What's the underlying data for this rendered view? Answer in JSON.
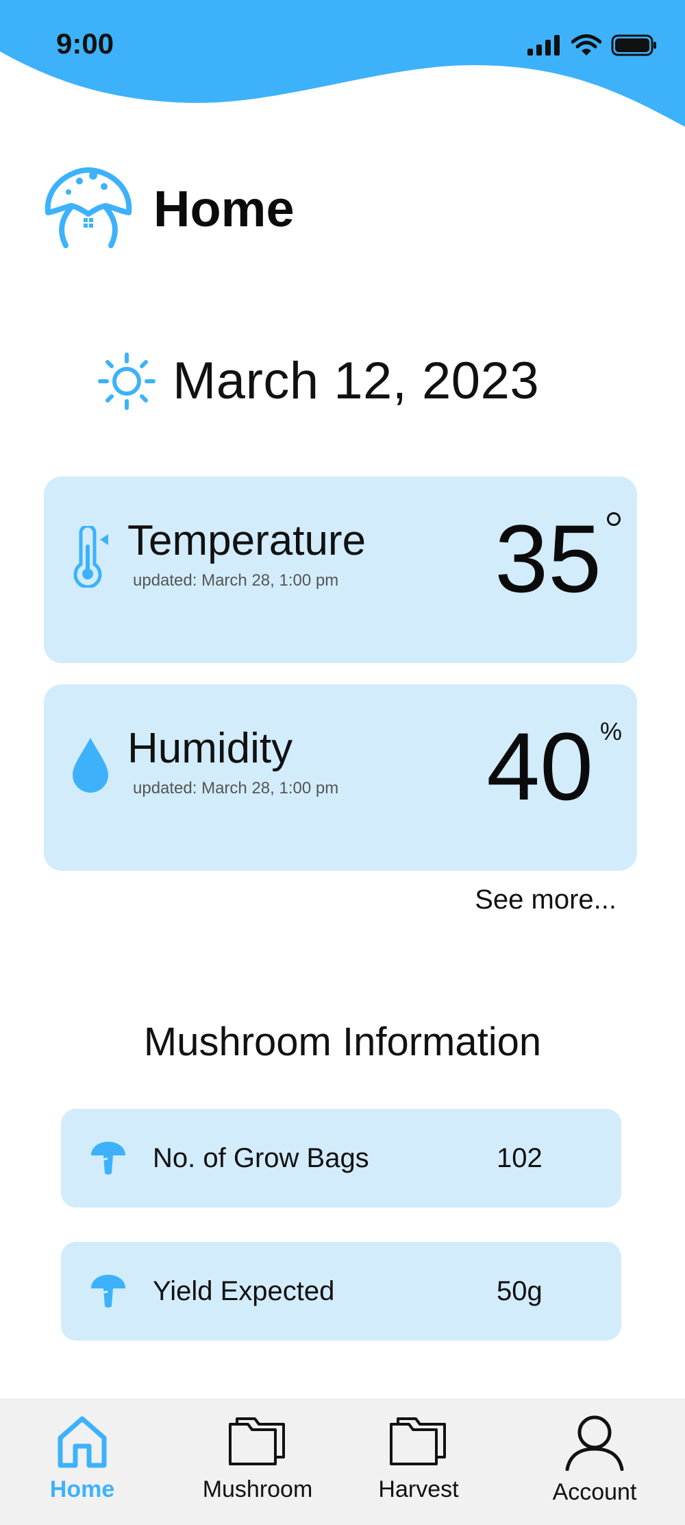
{
  "status_bar": {
    "time": "9:00"
  },
  "header": {
    "title": "Home"
  },
  "date": {
    "text": "March 12, 2023"
  },
  "sensors": {
    "temperature": {
      "title": "Temperature",
      "updated": "updated: March 28, 1:00 pm",
      "value": "35"
    },
    "humidity": {
      "title": "Humidity",
      "updated": "updated: March 28, 1:00 pm",
      "value": "40",
      "unit": "%"
    }
  },
  "see_more": "See more...",
  "mushroom_info": {
    "title": "Mushroom Information",
    "items": [
      {
        "label": "No. of Grow Bags",
        "value": "102"
      },
      {
        "label": "Yield Expected",
        "value": "50g"
      }
    ]
  },
  "nav": {
    "items": [
      {
        "label": "Home",
        "icon": "home-icon",
        "active": true
      },
      {
        "label": "Mushroom",
        "icon": "folder-icon"
      },
      {
        "label": "Harvest",
        "icon": "folder-icon"
      },
      {
        "label": "Account",
        "icon": "user-icon"
      }
    ]
  },
  "colors": {
    "accent": "#3db2fb",
    "card_bg": "#d2ecfb",
    "nav_bg": "#f1f1f1"
  }
}
